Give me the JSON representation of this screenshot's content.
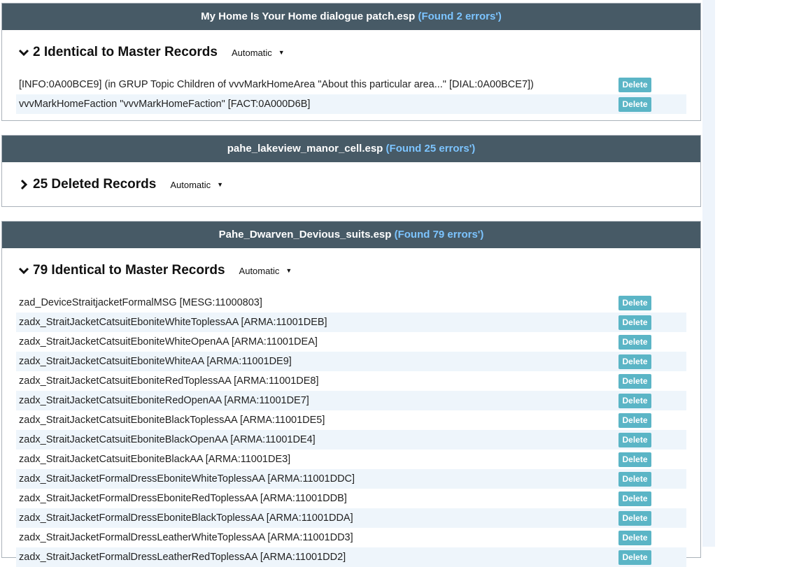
{
  "panels": [
    {
      "file": "My Home Is Your Home dialogue patch.esp",
      "errors": "(Found 2 errors')",
      "group": {
        "title": "2 Identical to Master Records",
        "mode": "Automatic",
        "expanded": true,
        "records": [
          "[INFO:0A00BCE9] (in GRUP Topic Children of vvvMarkHomeArea \"About this particular area...\" [DIAL:0A00BCE7])",
          "vvvMarkHomeFaction \"vvvMarkHomeFaction\" [FACT:0A000D6B]"
        ]
      }
    },
    {
      "file": "pahe_lakeview_manor_cell.esp",
      "errors": "(Found 25 errors')",
      "group": {
        "title": "25 Deleted Records",
        "mode": "Automatic",
        "expanded": false,
        "records": []
      }
    },
    {
      "file": "Pahe_Dwarven_Devious_suits.esp",
      "errors": "(Found 79 errors')",
      "group": {
        "title": "79 Identical to Master Records",
        "mode": "Automatic",
        "expanded": true,
        "records": [
          "zad_DeviceStraitjacketFormalMSG [MESG:11000803]",
          "zadx_StraitJacketCatsuitEboniteWhiteToplessAA [ARMA:11001DEB]",
          "zadx_StraitJacketCatsuitEboniteWhiteOpenAA [ARMA:11001DEA]",
          "zadx_StraitJacketCatsuitEboniteWhiteAA [ARMA:11001DE9]",
          "zadx_StraitJacketCatsuitEboniteRedToplessAA [ARMA:11001DE8]",
          "zadx_StraitJacketCatsuitEboniteRedOpenAA [ARMA:11001DE7]",
          "zadx_StraitJacketCatsuitEboniteBlackToplessAA [ARMA:11001DE5]",
          "zadx_StraitJacketCatsuitEboniteBlackOpenAA [ARMA:11001DE4]",
          "zadx_StraitJacketCatsuitEboniteBlackAA [ARMA:11001DE3]",
          "zadx_StraitJacketFormalDressEboniteWhiteToplessAA [ARMA:11001DDC]",
          "zadx_StraitJacketFormalDressEboniteRedToplessAA [ARMA:11001DDB]",
          "zadx_StraitJacketFormalDressEboniteBlackToplessAA [ARMA:11001DDA]",
          "zadx_StraitJacketFormalDressLeatherWhiteToplessAA [ARMA:11001DD3]",
          "zadx_StraitJacketFormalDressLeatherRedToplessAA [ARMA:11001DD2]"
        ]
      }
    }
  ],
  "delete_label": "Delete",
  "colors": {
    "header_bg": "#475a66",
    "error_text": "#7cc4ff",
    "delete_bg": "#5bb5c6",
    "alt_row_bg": "#eef5fb"
  }
}
